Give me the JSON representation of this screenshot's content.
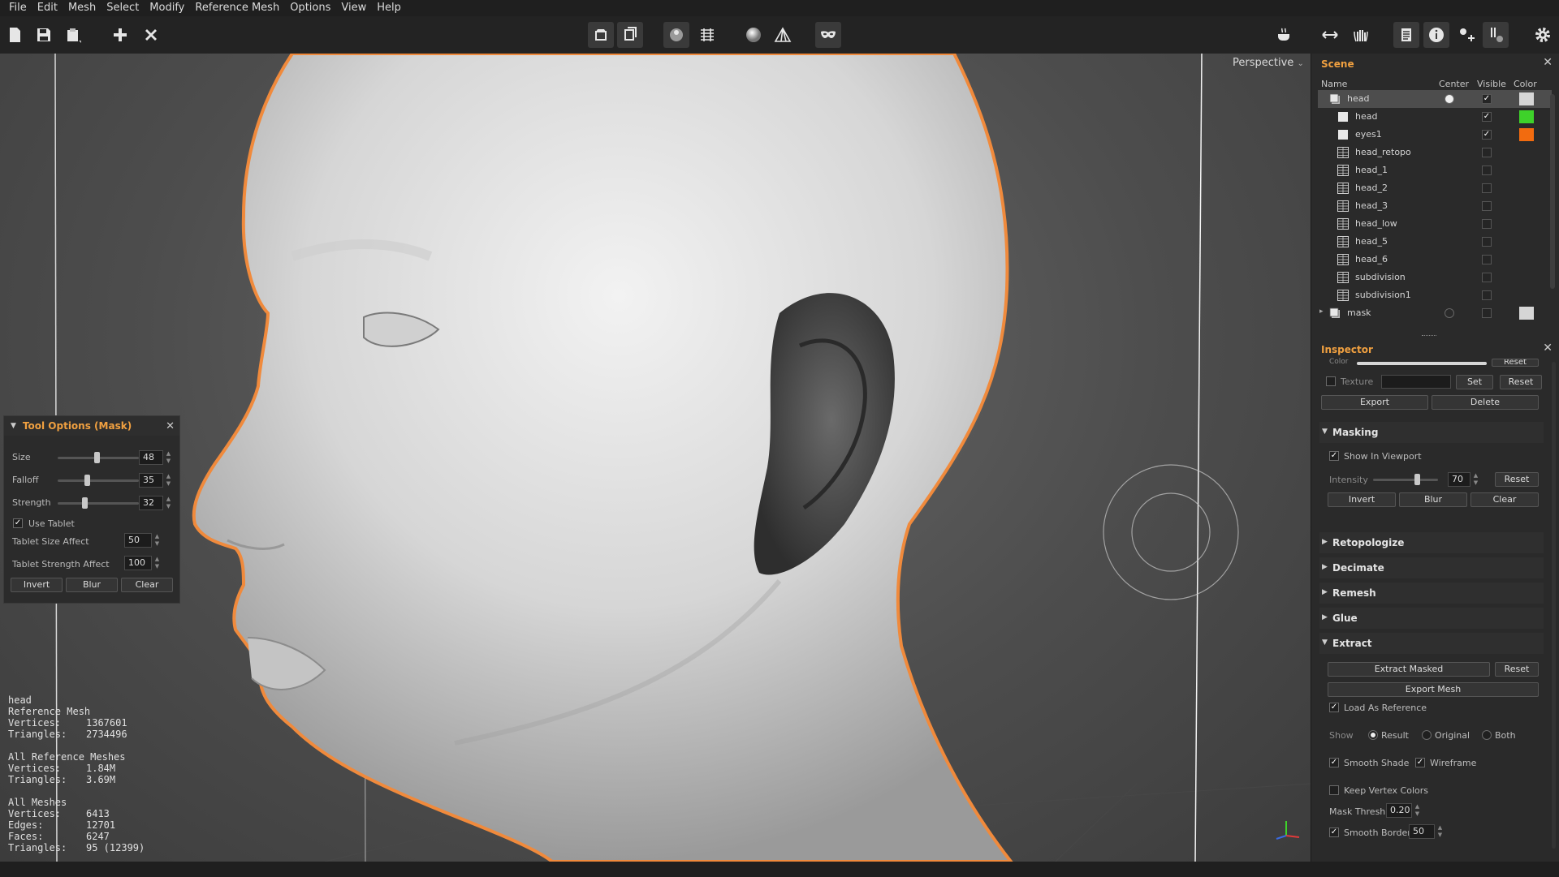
{
  "menu": [
    "File",
    "Edit",
    "Mesh",
    "Select",
    "Modify",
    "Reference Mesh",
    "Options",
    "View",
    "Help"
  ],
  "toolbar": {
    "icons": [
      "new-file-icon",
      "save-icon",
      "open-file-icon",
      "add-icon",
      "close-icon",
      "camera-front-icon",
      "cube-icon",
      "material-icon",
      "grid-icon",
      "sphere-icon",
      "wireframe-icon",
      "mask-icon",
      "coffee-icon",
      "arrows-icon",
      "hand-icon",
      "layers-icon",
      "info-icon",
      "transform-icon",
      "tools-icon",
      "settings-icon"
    ]
  },
  "viewport": {
    "camera": "Perspective",
    "camera_suffix": "⌄"
  },
  "tool_options": {
    "title": "Tool Options (Mask)",
    "size_label": "Size",
    "size_value": "48",
    "size_fraction": 0.48,
    "falloff_label": "Falloff",
    "falloff_value": "35",
    "falloff_fraction": 0.35,
    "strength_label": "Strength",
    "strength_value": "32",
    "strength_fraction": 0.32,
    "use_tablet_label": "Use Tablet",
    "use_tablet_checked": true,
    "tablet_size_label": "Tablet Size Affect",
    "tablet_size_value": "50",
    "tablet_strength_label": "Tablet Strength Affect",
    "tablet_strength_value": "100",
    "invert_label": "Invert",
    "blur_label": "Blur",
    "clear_label": "Clear"
  },
  "stats": {
    "mesh_name": "head",
    "ref_header": "Reference Mesh",
    "ref_vertices_label": "Vertices:",
    "ref_vertices": "1367601",
    "ref_triangles_label": "Triangles:",
    "ref_triangles": "2734496",
    "all_ref_header": "All Reference Meshes",
    "all_ref_vertices_label": "Vertices:",
    "all_ref_vertices": "1.84M",
    "all_ref_triangles_label": "Triangles:",
    "all_ref_triangles": "3.69M",
    "all_header": "All Meshes",
    "all_vertices_label": "Vertices:",
    "all_vertices": "6413",
    "all_edges_label": "Edges:",
    "all_edges": "12701",
    "all_faces_label": "Faces:",
    "all_faces": "6247",
    "all_triangles_label": "Triangles:",
    "all_triangles": "95 (12399)"
  },
  "scene": {
    "title": "Scene",
    "col_name": "Name",
    "col_center": "Center",
    "col_visible": "Visible",
    "col_color": "Color",
    "rows": [
      {
        "name": "head",
        "kind": "group",
        "visible": true,
        "color": "#d6d6d6",
        "selected": true
      },
      {
        "name": "head",
        "kind": "mesh-solid",
        "visible": true,
        "color": "#3ed22a"
      },
      {
        "name": "eyes1",
        "kind": "mesh-solid",
        "visible": true,
        "color": "#f26b0f"
      },
      {
        "name": "head_retopo",
        "kind": "grid",
        "visible": false
      },
      {
        "name": "head_1",
        "kind": "grid",
        "visible": false
      },
      {
        "name": "head_2",
        "kind": "grid",
        "visible": false
      },
      {
        "name": "head_3",
        "kind": "grid",
        "visible": false
      },
      {
        "name": "head_low",
        "kind": "grid",
        "visible": false
      },
      {
        "name": "head_5",
        "kind": "grid",
        "visible": false
      },
      {
        "name": "head_6",
        "kind": "grid",
        "visible": false
      },
      {
        "name": "subdivision",
        "kind": "grid",
        "visible": false
      },
      {
        "name": "subdivision1",
        "kind": "grid",
        "visible": false
      },
      {
        "name": "mask",
        "kind": "group",
        "visible": false,
        "color": "#d6d6d6"
      }
    ]
  },
  "inspector": {
    "title": "Inspector",
    "color_label": "Color",
    "color_reset": "Reset",
    "texture_label": "Texture",
    "set_label": "Set",
    "texture_reset": "Reset",
    "export_label": "Export",
    "delete_label": "Delete",
    "masking": {
      "title": "Masking",
      "show_in_viewport": "Show In Viewport",
      "intensity_label": "Intensity",
      "intensity_value": "70",
      "intensity_fraction": 0.7,
      "reset": "Reset",
      "invert": "Invert",
      "blur": "Blur",
      "clear": "Clear"
    },
    "collapsed_sections": [
      "Retopologize",
      "Decimate",
      "Remesh",
      "Glue"
    ],
    "extract": {
      "title": "Extract",
      "extract_masked": "Extract Masked",
      "reset": "Reset",
      "export_mesh": "Export Mesh",
      "load_as_reference": "Load As Reference",
      "show_label": "Show",
      "show_result": "Result",
      "show_original": "Original",
      "show_both": "Both",
      "smooth_shade": "Smooth Shade",
      "wireframe": "Wireframe",
      "keep_vertex_colors": "Keep Vertex Colors",
      "mask_thresh_label": "Mask Thresh",
      "mask_thresh_value": "0.20",
      "smooth_border_label": "Smooth Border",
      "smooth_border_value": "50"
    }
  },
  "colors": {
    "accent": "#f0a040",
    "outline": "#f08a3c",
    "green": "#3ed22a",
    "orange": "#f26b0f"
  }
}
